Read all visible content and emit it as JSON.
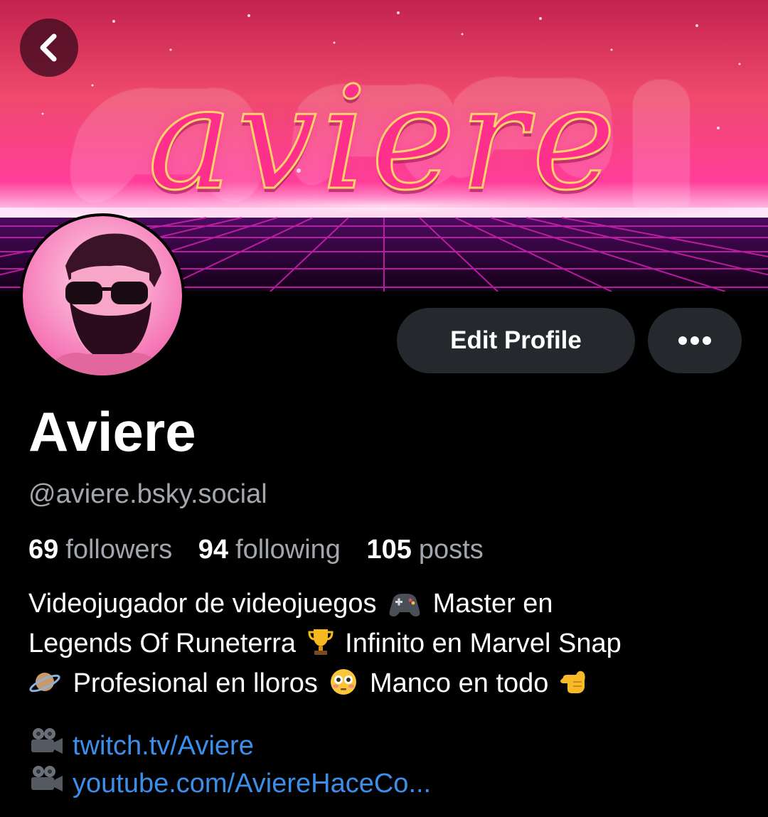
{
  "header": {
    "banner_wordmark": "aviere",
    "back_icon": "chevron-left-icon"
  },
  "profile": {
    "display_name": "Aviere",
    "handle": "@aviere.bsky.social",
    "stats": {
      "followers_count": "69",
      "followers_label": "followers",
      "following_count": "94",
      "following_label": "following",
      "posts_count": "105",
      "posts_label": "posts"
    },
    "bio": {
      "line1": {
        "text_a": "Videojugador de videojuegos",
        "emoji_a": "gamepad-emoji",
        "text_b": "Master en"
      },
      "line2": {
        "text_a": "Legends Of Runeterra",
        "emoji_a": "trophy-emoji",
        "text_b": "Infinito en Marvel Snap"
      },
      "line3": {
        "emoji_a": "ringed-planet-emoji",
        "text_a": "Profesional en lloros",
        "emoji_b": "flushed-face-emoji",
        "text_b": "Manco en todo",
        "emoji_c": "hand-pointing-left-emoji"
      }
    },
    "links": [
      {
        "icon": "movie-camera-emoji",
        "text": "twitch.tv/Aviere"
      },
      {
        "icon": "movie-camera-emoji",
        "text": "youtube.com/AviereHaceCo..."
      }
    ]
  },
  "actions": {
    "edit_profile_label": "Edit Profile",
    "more_icon": "ellipsis-icon"
  },
  "colors": {
    "background": "#000000",
    "button_bg": "#25282d",
    "secondary_text": "#a3a7ad",
    "link": "#3b8fea",
    "banner_pink": "#ff2f8c",
    "banner_grid": "#c71aa8"
  }
}
